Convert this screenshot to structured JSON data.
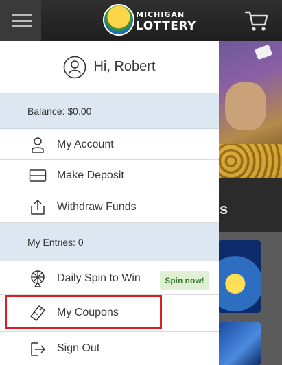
{
  "header": {
    "logo_line1": "MICHIGAN",
    "logo_line2": "LOTTERY",
    "menu_icon": "hamburger-menu-icon",
    "cart_icon": "shopping-cart-icon"
  },
  "drawer": {
    "greeting": "Hi, Robert",
    "balance_label": "Balance: $0.00",
    "account_items": [
      {
        "label": "My Account",
        "icon": "user-icon"
      },
      {
        "label": "Make Deposit",
        "icon": "wallet-icon"
      },
      {
        "label": "Withdraw Funds",
        "icon": "withdraw-icon"
      }
    ],
    "entries_label": "My Entries: 0",
    "entry_items": [
      {
        "label": "Daily Spin to Win",
        "icon": "wheel-icon",
        "badge": "Spin now!"
      },
      {
        "label": "My Coupons",
        "icon": "coupon-icon"
      },
      {
        "label": "Sign Out",
        "icon": "sign-out-icon"
      }
    ]
  },
  "background": {
    "panel_title_fragment": "s"
  },
  "colors": {
    "header_bg": "#2a2a2a",
    "section_bg": "#dce7f2",
    "badge_bg": "#dff0d5",
    "badge_text": "#3e7a2e",
    "highlight": "#e21c26"
  }
}
